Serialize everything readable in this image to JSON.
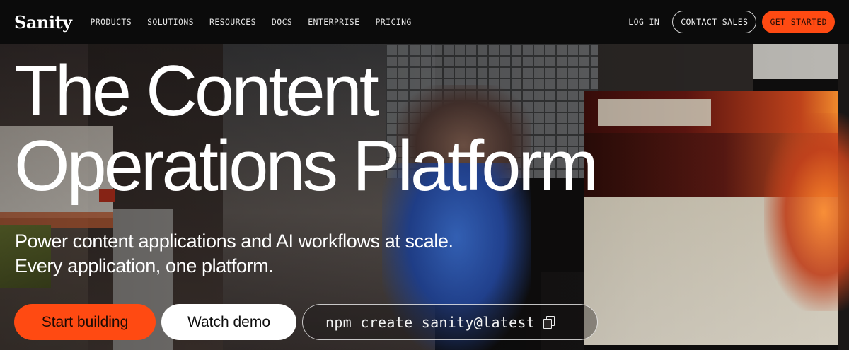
{
  "header": {
    "logo": "Sanity",
    "nav": [
      "PRODUCTS",
      "SOLUTIONS",
      "RESOURCES",
      "DOCS",
      "ENTERPRISE",
      "PRICING"
    ],
    "login": "LOG IN",
    "contact_sales": "CONTACT SALES",
    "get_started": "GET STARTED"
  },
  "hero": {
    "title_line1": "The Content",
    "title_line2": "Operations Platform",
    "subtitle_line1": "Power content applications and AI workflows at scale.",
    "subtitle_line2": "Every application, one platform.",
    "start_building": "Start building",
    "watch_demo": "Watch demo",
    "npm_command": "npm create sanity@latest",
    "copy_icon": "copy-icon"
  },
  "colors": {
    "accent": "#ff4a12",
    "nav_bg": "#0b0b0b",
    "text": "#ffffff"
  }
}
